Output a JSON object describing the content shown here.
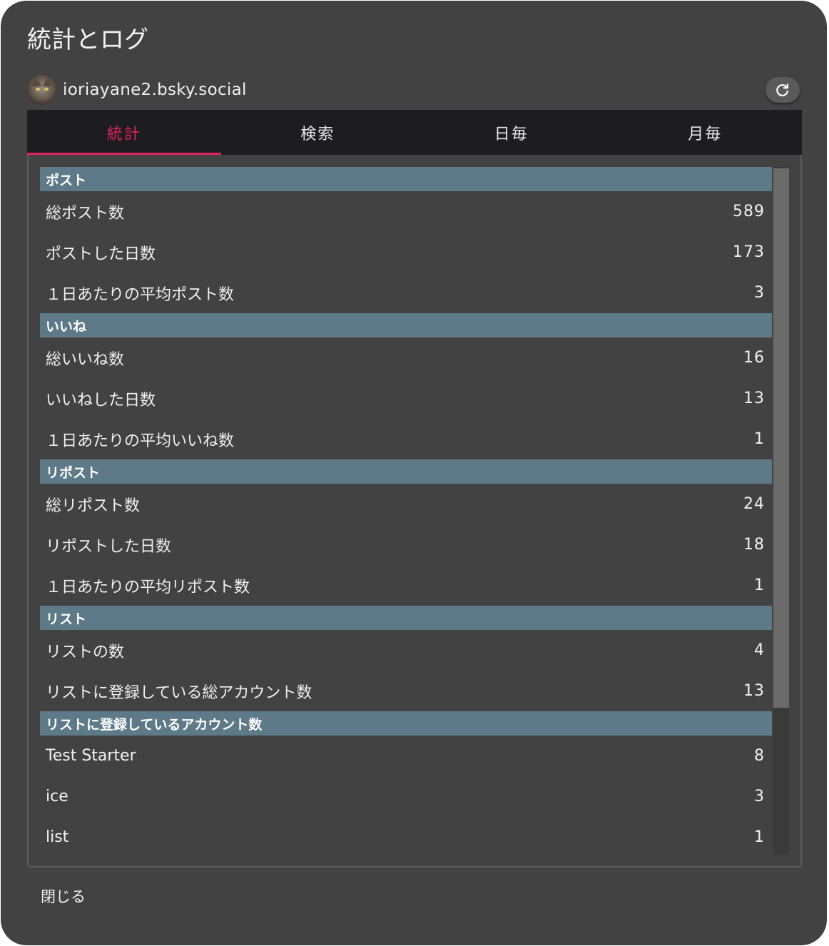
{
  "title": "統計とログ",
  "account": {
    "handle": "ioriayane2.bsky.social",
    "avatar_icon": "cat-avatar"
  },
  "refresh_icon": "refresh-icon",
  "tabs": [
    {
      "label": "統計",
      "active": true
    },
    {
      "label": "検索",
      "active": false
    },
    {
      "label": "日毎",
      "active": false
    },
    {
      "label": "月毎",
      "active": false
    }
  ],
  "sections": [
    {
      "title": "ポスト",
      "rows": [
        {
          "label": "総ポスト数",
          "value": "589"
        },
        {
          "label": "ポストした日数",
          "value": "173"
        },
        {
          "label": "１日あたりの平均ポスト数",
          "value": "3"
        }
      ]
    },
    {
      "title": "いいね",
      "rows": [
        {
          "label": "総いいね数",
          "value": "16"
        },
        {
          "label": "いいねした日数",
          "value": "13"
        },
        {
          "label": "１日あたりの平均いいね数",
          "value": "1"
        }
      ]
    },
    {
      "title": "リポスト",
      "rows": [
        {
          "label": "総リポスト数",
          "value": "24"
        },
        {
          "label": "リポストした日数",
          "value": "18"
        },
        {
          "label": "１日あたりの平均リポスト数",
          "value": "1"
        }
      ]
    },
    {
      "title": "リスト",
      "rows": [
        {
          "label": "リストの数",
          "value": "4"
        },
        {
          "label": "リストに登録している総アカウント数",
          "value": "13"
        }
      ]
    },
    {
      "title": "リストに登録しているアカウント数",
      "rows": [
        {
          "label": "Test Starter",
          "value": "8"
        },
        {
          "label": "ice",
          "value": "3"
        },
        {
          "label": "list",
          "value": "1"
        }
      ]
    }
  ],
  "close_label": "閉じる",
  "colors": {
    "dialog_bg": "#424242",
    "tab_bar_bg": "#1d1c21",
    "accent": "#e0245e",
    "section_header_bg": "#5e7987"
  }
}
